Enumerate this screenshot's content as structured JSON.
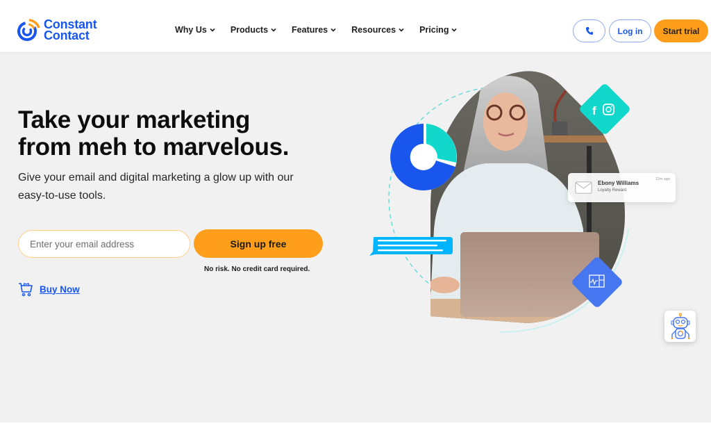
{
  "header": {
    "logo": {
      "line1": "Constant",
      "line2": "Contact",
      "icon": "constant-contact-logo-icon"
    },
    "nav": [
      {
        "label": "Why Us",
        "icon": "chevron-down-icon"
      },
      {
        "label": "Products",
        "icon": "chevron-down-icon"
      },
      {
        "label": "Features",
        "icon": "chevron-down-icon"
      },
      {
        "label": "Resources",
        "icon": "chevron-down-icon"
      },
      {
        "label": "Pricing",
        "icon": "chevron-down-icon"
      }
    ],
    "phone_icon": "phone-icon",
    "login_label": "Log in",
    "trial_label": "Start trial"
  },
  "hero": {
    "headline_line1": "Take your marketing",
    "headline_line2": "from meh to marvelous.",
    "subhead": "Give your email and digital marketing a glow up with our easy-to-use tools.",
    "email_placeholder": "Enter your email address",
    "email_value": "",
    "signup_label": "Sign up free",
    "no_risk": "No risk. No credit card required.",
    "buy_now_label": "Buy Now",
    "buy_now_icon": "shopping-cart-icon"
  },
  "illustration": {
    "notification": {
      "name": "Ebony Williams",
      "subtitle": "Loyalty Reward",
      "time": "12m ago",
      "icon": "envelope-icon"
    },
    "social_icons": [
      "facebook-icon",
      "instagram-icon"
    ],
    "analytics_icon": "analytics-chart-icon",
    "donut_shares": {
      "primary": 0.72,
      "secondary": 0.28
    }
  },
  "colors": {
    "brand_blue": "#1856ed",
    "accent_orange": "#ff9e1b",
    "teal": "#12d8cc",
    "chat_blue": "#00b5ff",
    "diamond_blue": "#4677f0",
    "background": "#f1f1f1"
  },
  "chat_widget": {
    "icon": "chatbot-robot-icon"
  }
}
